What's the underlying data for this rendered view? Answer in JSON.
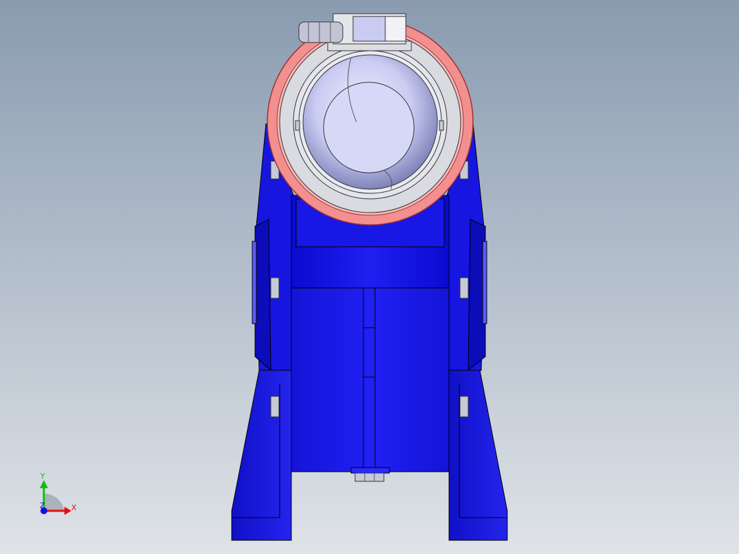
{
  "viewport": {
    "background_top": "#8a9bb0",
    "background_bottom": "#dfe3e7"
  },
  "model": {
    "body_color": "#1d1de8",
    "body_dark": "#0c0ca8",
    "body_light": "#4a4aff",
    "band_color": "#f08c8c",
    "ring_color": "#d9d9dd",
    "dome_color": "#c9cbf2",
    "hardware_color": "#c6c9d8"
  },
  "triad": {
    "x_label": "X",
    "y_label": "Y",
    "z_label": "Z",
    "x_color": "#e01010",
    "y_color": "#10c010",
    "z_color": "#1010e0"
  }
}
